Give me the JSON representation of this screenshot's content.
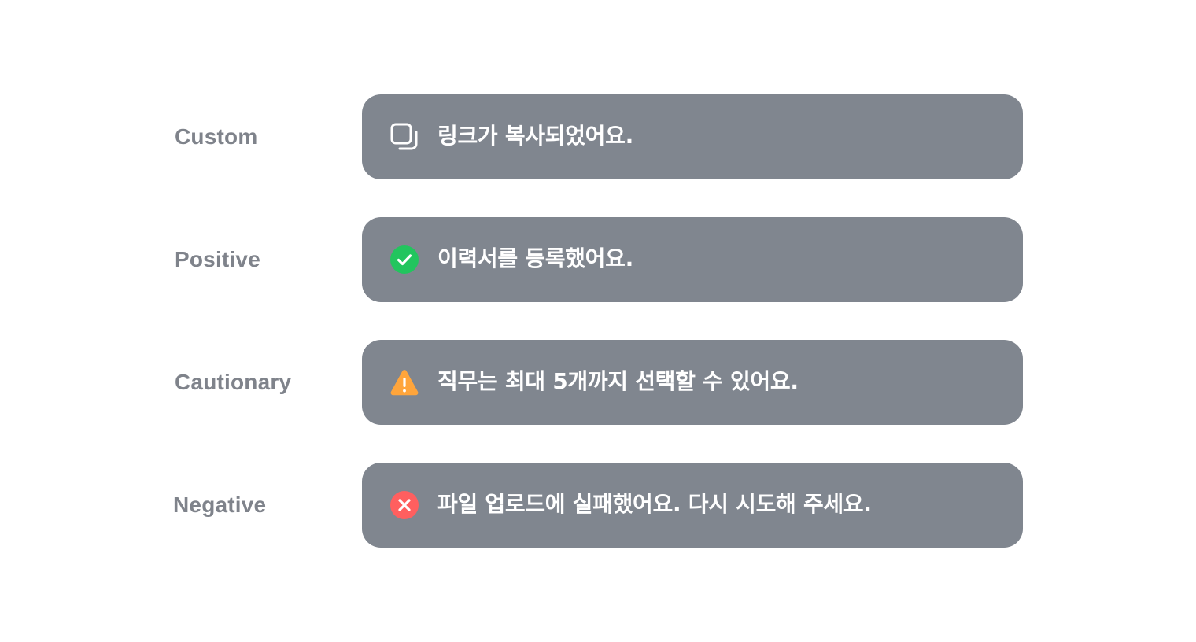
{
  "toasts": [
    {
      "label": "Custom",
      "icon": "copy-icon",
      "message": "링크가 복사되었어요."
    },
    {
      "label": "Positive",
      "icon": "check-circle-icon",
      "icon_color": "#22c55e",
      "message": "이력서를 등록했어요."
    },
    {
      "label": "Cautionary",
      "icon": "warning-triangle-icon",
      "icon_color": "#ffa53b",
      "message": "직무는 최대 5개까지 선택할 수 있어요."
    },
    {
      "label": "Negative",
      "icon": "close-circle-icon",
      "icon_color": "#ff5f5f",
      "message": "파일 업로드에 실패했어요. 다시 시도해 주세요."
    }
  ],
  "colors": {
    "toast_background": "#80868f",
    "label_text": "#7f838b",
    "toast_text": "#ffffff"
  }
}
